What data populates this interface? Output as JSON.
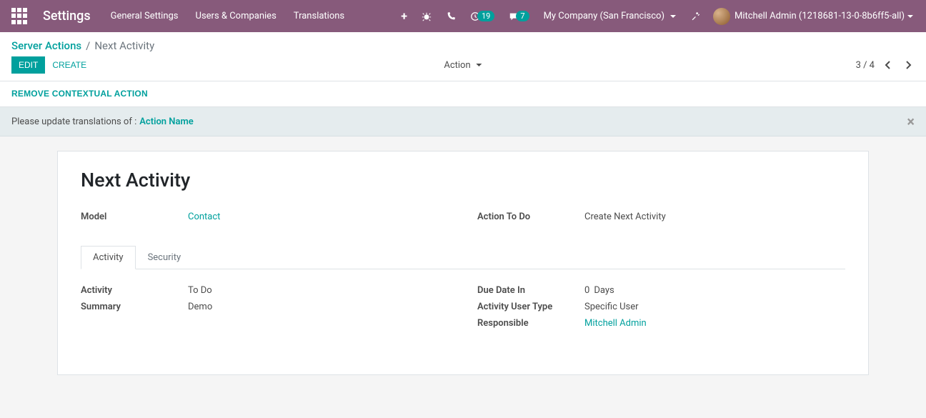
{
  "topnav": {
    "brand": "Settings",
    "links": [
      "General Settings",
      "Users & Companies",
      "Translations"
    ],
    "badges": {
      "clock": "19",
      "chat": "7"
    },
    "company": "My Company (San Francisco)",
    "user": "Mitchell Admin (1218681-13-0-8b6ff5-all)"
  },
  "breadcrumb": {
    "root": "Server Actions",
    "current": "Next Activity"
  },
  "buttons": {
    "edit": "EDIT",
    "create": "CREATE",
    "action_dropdown": "Action",
    "remove_contextual": "REMOVE CONTEXTUAL ACTION"
  },
  "pager": {
    "text": "3 / 4"
  },
  "alert": {
    "prefix": "Please update translations of :",
    "link": "Action Name"
  },
  "record": {
    "title": "Next Activity",
    "fields_left_top": {
      "model_label": "Model",
      "model_value": "Contact"
    },
    "fields_right_top": {
      "action_label": "Action To Do",
      "action_value": "Create Next Activity"
    },
    "tabs": {
      "activity": "Activity",
      "security": "Security"
    },
    "activity_tab": {
      "left": {
        "activity_label": "Activity",
        "activity_value": "To Do",
        "summary_label": "Summary",
        "summary_value": "Demo"
      },
      "right": {
        "due_label": "Due Date In",
        "due_value": "0",
        "due_unit": "Days",
        "usertype_label": "Activity User Type",
        "usertype_value": "Specific User",
        "responsible_label": "Responsible",
        "responsible_value": "Mitchell Admin"
      }
    }
  }
}
